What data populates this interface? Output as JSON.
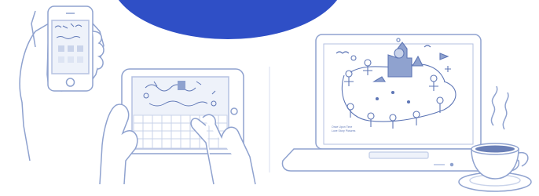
{
  "colors": {
    "background": "#ffffff",
    "accent_blue": "#2f4fc6",
    "line": "#8fa2cf",
    "line_light": "#c9d3ea",
    "fill": "#eef2fa",
    "drawing_ink": "#5f77b6"
  },
  "scene": {
    "devices": [
      {
        "name": "smartphone"
      },
      {
        "name": "tablet"
      },
      {
        "name": "laptop"
      }
    ],
    "props": [
      {
        "name": "coffee-cup"
      }
    ]
  },
  "laptop_screen": {
    "caption": "Once Upon Time\nLove Story Pictures"
  }
}
